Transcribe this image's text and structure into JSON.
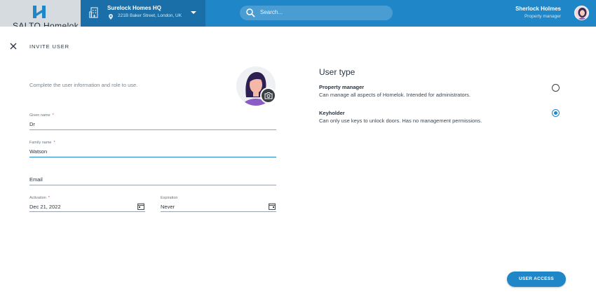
{
  "app": {
    "logo_text": "SALTO Homelok",
    "brand_color": "#1f86c7"
  },
  "site": {
    "name": "Surelock Homes HQ",
    "address": "221B Baker Street, London, UK",
    "icon": "building-icon"
  },
  "search": {
    "placeholder": "Search..."
  },
  "user": {
    "name": "Sherlock Holmes",
    "role": "Property manager"
  },
  "dialog": {
    "title": "INVITE USER",
    "intro": "Complete the user information and role to use."
  },
  "form": {
    "given_name": {
      "label": "Given name",
      "required": "*",
      "value": "Dr"
    },
    "family_name": {
      "label": "Family name",
      "required": "*",
      "value": "Watson"
    },
    "email": {
      "placeholder": "Email",
      "value": ""
    },
    "activation": {
      "label": "Activation",
      "required": "*",
      "value": "Dec 21, 2022"
    },
    "expiration": {
      "label": "Expiration",
      "value": "Never"
    }
  },
  "user_type": {
    "title": "User type",
    "options": [
      {
        "title": "Property manager",
        "description": "Can manage all aspects of Homelok. Intended for administrators.",
        "selected": false
      },
      {
        "title": "Keyholder",
        "description": "Can only use keys to unlock doors. Has no management permissions.",
        "selected": true
      }
    ]
  },
  "actions": {
    "submit_label": "USER ACCESS"
  }
}
